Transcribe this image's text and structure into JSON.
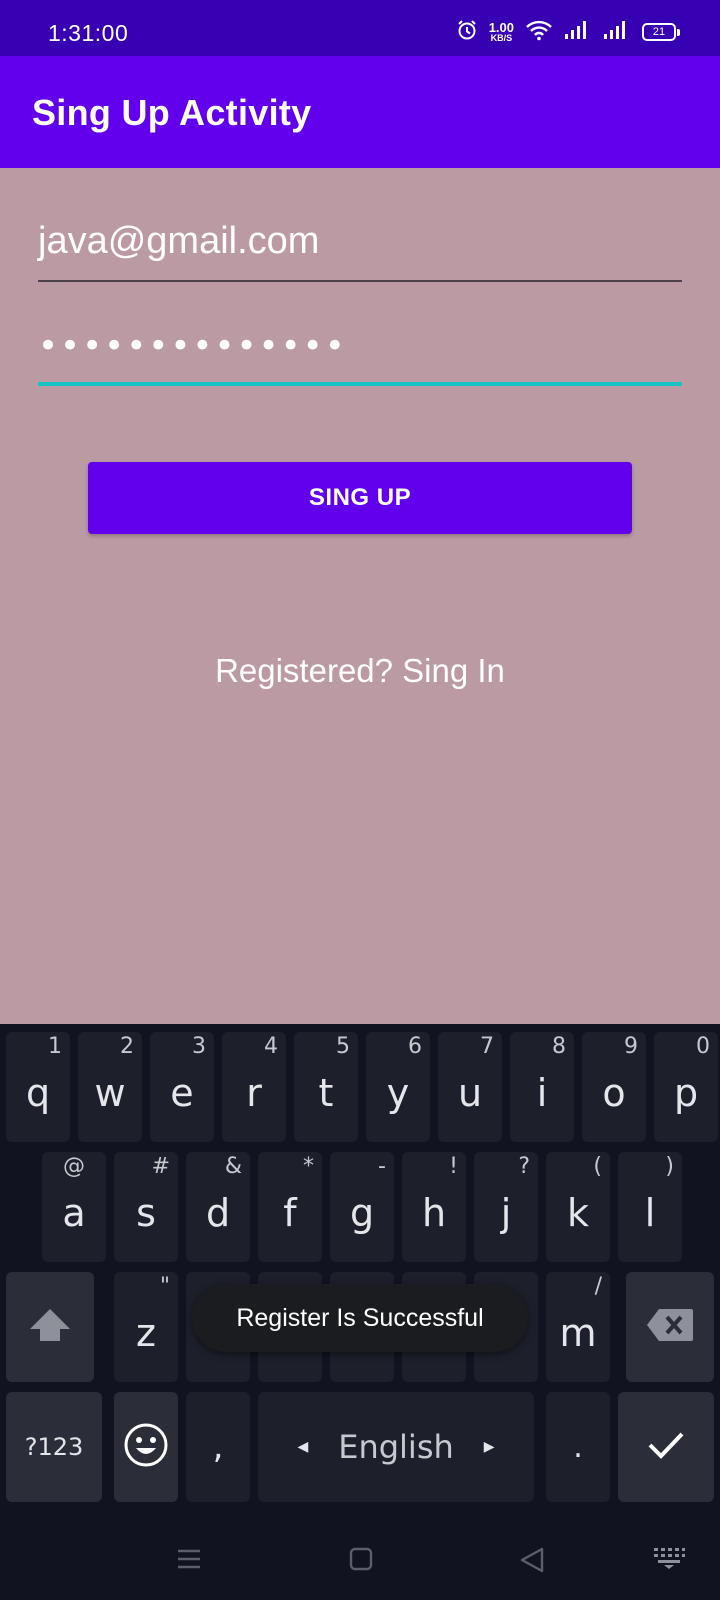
{
  "status_bar": {
    "time": "1:31:00",
    "speed_value": "1.00",
    "speed_unit": "KB/S",
    "battery": "21"
  },
  "app_bar": {
    "title": "Sing Up Activity"
  },
  "form": {
    "email_value": "java@gmail.com",
    "password_value": "••••••••••••••",
    "signup_button": "SING UP",
    "signin_link": "Registered? Sing In"
  },
  "keyboard": {
    "row1": [
      {
        "key": "q",
        "hint": "1"
      },
      {
        "key": "w",
        "hint": "2"
      },
      {
        "key": "e",
        "hint": "3"
      },
      {
        "key": "r",
        "hint": "4"
      },
      {
        "key": "t",
        "hint": "5"
      },
      {
        "key": "y",
        "hint": "6"
      },
      {
        "key": "u",
        "hint": "7"
      },
      {
        "key": "i",
        "hint": "8"
      },
      {
        "key": "o",
        "hint": "9"
      },
      {
        "key": "p",
        "hint": "0"
      }
    ],
    "row2": [
      {
        "key": "a",
        "hint": "@"
      },
      {
        "key": "s",
        "hint": "#"
      },
      {
        "key": "d",
        "hint": "&"
      },
      {
        "key": "f",
        "hint": "*"
      },
      {
        "key": "g",
        "hint": "-"
      },
      {
        "key": "h",
        "hint": "!"
      },
      {
        "key": "j",
        "hint": "?"
      },
      {
        "key": "k",
        "hint": "("
      },
      {
        "key": "l",
        "hint": ")"
      }
    ],
    "row3": {
      "z": "z",
      "z_hint": "\"",
      "m": "m",
      "m_hint": "/"
    },
    "row4": {
      "symbols": "?123",
      "comma": ",",
      "space": "English",
      "period": "."
    },
    "colors": {
      "background": "#111420",
      "key": "#1d202b",
      "text": "#e4e6ea"
    }
  },
  "toast": {
    "message": "Register Is Successful"
  },
  "icons": [
    "alarm-icon",
    "wifi-icon",
    "signal-icon",
    "battery-icon",
    "shift-icon",
    "backspace-icon",
    "emoji-icon",
    "enter-check-icon",
    "menu-icon",
    "home-icon",
    "back-icon",
    "keyboard-icon"
  ],
  "colors": {
    "status_bar": "#3700b3",
    "app_bar": "#6200ee",
    "background": "#bc9aa4",
    "accent": "#19c2c2"
  }
}
